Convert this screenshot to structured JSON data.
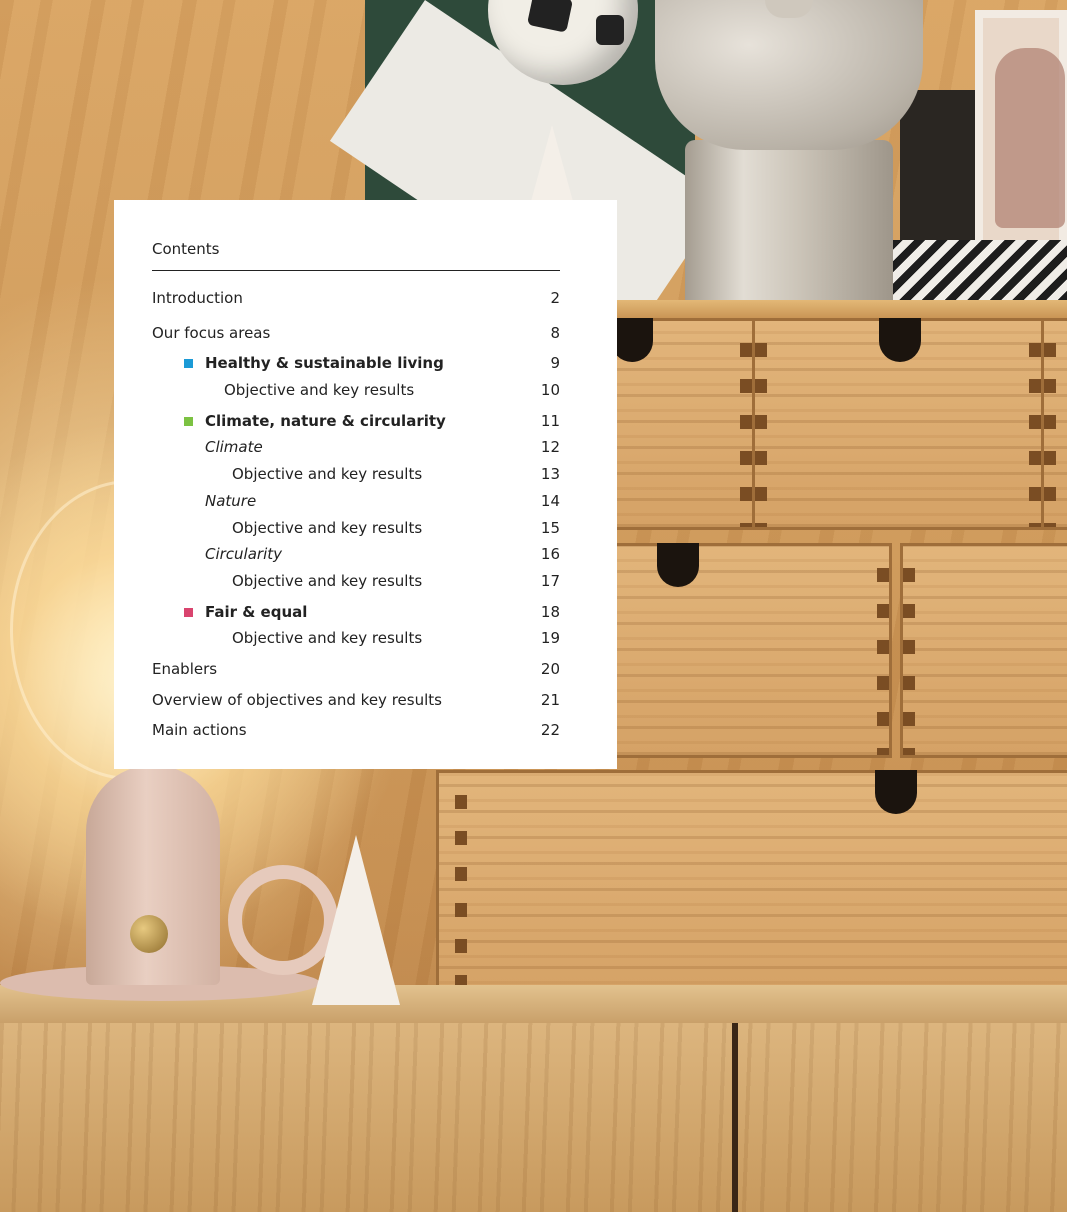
{
  "contents": {
    "title": "Contents",
    "entries": [
      {
        "label": "Introduction",
        "page": "2"
      },
      {
        "label": "Our focus areas",
        "page": "8"
      },
      {
        "label": "Healthy & sustainable living",
        "page": "9",
        "marker_color": "#1b9ad6"
      },
      {
        "label": "Objective and key results",
        "page": "10"
      },
      {
        "label": "Climate, nature & circularity",
        "page": "11",
        "marker_color": "#7cc242"
      },
      {
        "label": "Climate",
        "page": "12"
      },
      {
        "label": "Objective and key results",
        "page": "13"
      },
      {
        "label": "Nature",
        "page": "14"
      },
      {
        "label": "Objective and key results",
        "page": "15"
      },
      {
        "label": "Circularity",
        "page": "16"
      },
      {
        "label": "Objective and key results",
        "page": "17"
      },
      {
        "label": "Fair & equal",
        "page": "18",
        "marker_color": "#d9446e"
      },
      {
        "label": "Objective and key results",
        "page": "19"
      },
      {
        "label": "Enablers",
        "page": "20"
      },
      {
        "label": "Overview of objectives and key results",
        "page": "21"
      },
      {
        "label": "Main actions",
        "page": "22"
      }
    ]
  },
  "background": {
    "icons": [
      "wooden-drawers",
      "table-lamp",
      "ceramic-jar",
      "paper-tree",
      "football-poster"
    ]
  }
}
